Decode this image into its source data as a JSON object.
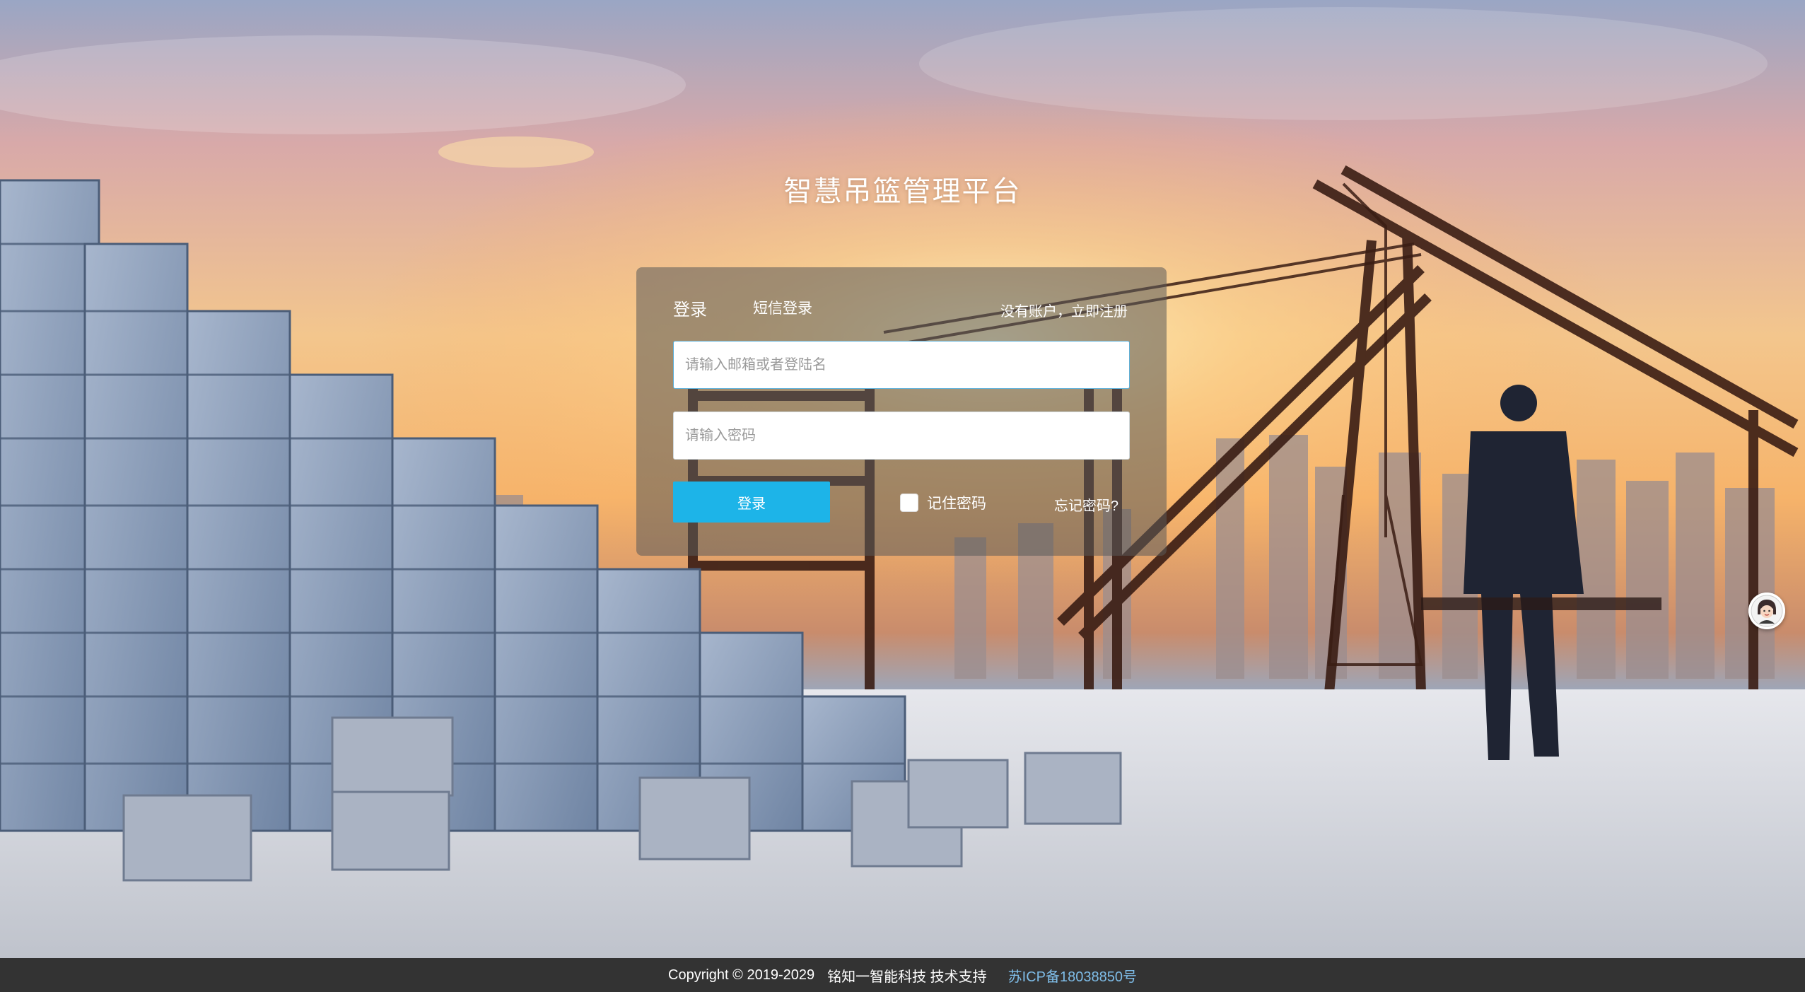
{
  "page": {
    "title": "智慧吊篮管理平台"
  },
  "login": {
    "tab_login": "登录",
    "tab_sms": "短信登录",
    "register_link": "没有账户，立即注册",
    "username_placeholder": "请输入邮箱或者登陆名",
    "password_placeholder": "请输入密码",
    "login_button": "登录",
    "remember_label": "记住密码",
    "forgot_link": "忘记密码?"
  },
  "footer": {
    "copyright": "Copyright © 2019-2029",
    "company": "铭知一智能科技 技术支持",
    "icp": "苏ICP备18038850号"
  },
  "colors": {
    "primary_button": "#1db4e8",
    "footer_bg": "#333333",
    "icp_link": "#7fbde8"
  },
  "icons": {
    "chat_avatar": "customer-service-avatar-icon"
  }
}
